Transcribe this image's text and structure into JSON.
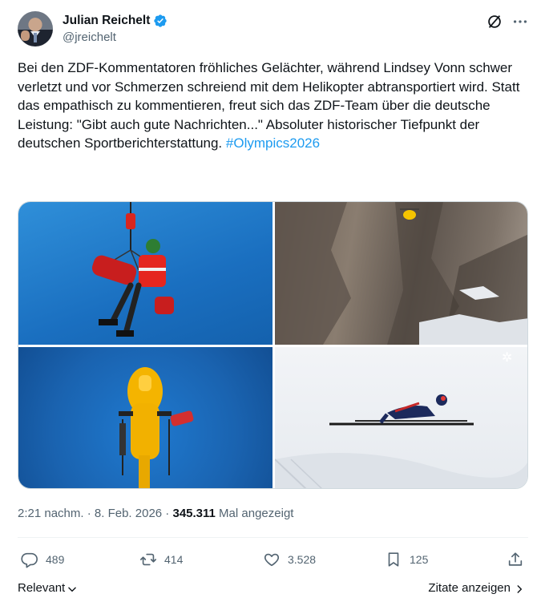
{
  "author": {
    "display_name": "Julian Reichelt",
    "handle": "@jreichelt",
    "verified_color": "#1d9bf0"
  },
  "header_icons": [
    "grok-icon",
    "more-icon"
  ],
  "tweet": {
    "text": "Bei den ZDF-Kommentatoren fröhliches Gelächter, während Lindsey Vonn schwer verletzt und vor Schmerzen schreiend mit dem Helikopter abtransportiert wird. Statt das empathisch zu kommentieren, freut sich das ZDF-Team über die deutsche Leistung: \"Gibt auch gute Nachrichten...\" Absoluter historischer Tiefpunkt der deutschen Sportberichterstattung. ",
    "hashtag": "#Olympics2026",
    "hashtag_color": "#1d9bf0"
  },
  "media": {
    "photos": [
      "photo-1",
      "photo-2",
      "photo-3",
      "photo-4"
    ]
  },
  "meta": {
    "time": "2:21 nachm.",
    "sep1": " · ",
    "date": "8. Feb. 2026",
    "sep2": " · ",
    "views": "345.311",
    "views_label": " Mal angezeigt"
  },
  "actions": {
    "replies": "489",
    "reposts": "414",
    "likes": "3.528",
    "bookmarks": "125"
  },
  "footer": {
    "sort_label": "Relevant",
    "quotes_label": "Zitate anzeigen"
  }
}
